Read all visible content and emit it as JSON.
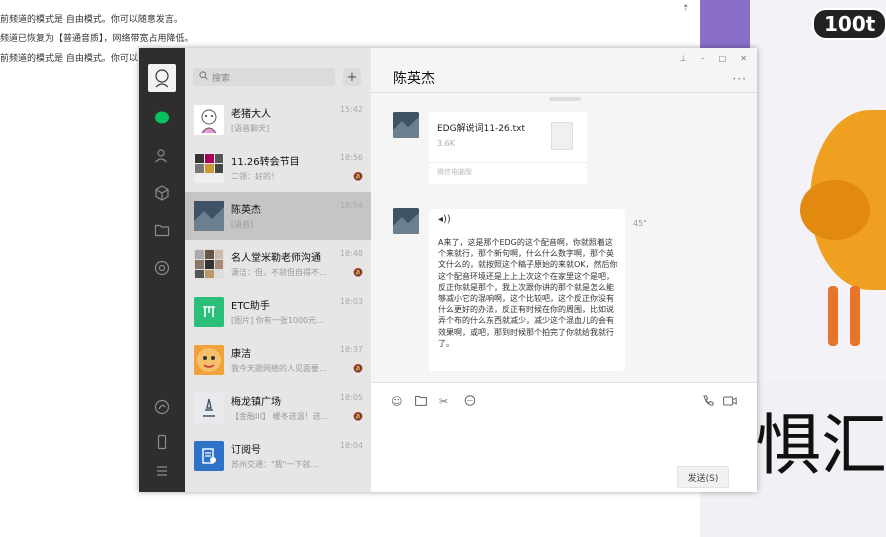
{
  "background": {
    "lines": [
      "前频道的模式是 自由模式。你可以随意发言。",
      "频道已恢复为【普通音质】，网络带宽占用降低。",
      "前频道的模式是 自由模式。你可以"
    ],
    "top_icon": "pin-icon",
    "video_badge": "100t",
    "video_caption": "惧汇总"
  },
  "wechat": {
    "window_controls": [
      "⊥",
      "–",
      "□",
      "✕"
    ],
    "rail_icons": [
      "chat-icon",
      "contacts-icon",
      "favorites-icon",
      "files-icon",
      "moments-icon",
      "mini-program-icon",
      "phone-icon",
      "menu-icon"
    ],
    "search_placeholder": "搜索",
    "add_label": "+",
    "conversations": [
      {
        "name": "老猪大人",
        "preview": "[语音聊天]",
        "time": "15:42",
        "muted": false
      },
      {
        "name": "11.26转会节目",
        "preview": "二领：好的！",
        "time": "18:56",
        "muted": true
      },
      {
        "name": "陈英杰",
        "preview": "[语音]",
        "time": "18:54",
        "muted": false,
        "selected": true
      },
      {
        "name": "名人堂米勒老师沟通",
        "preview": "潇洁：但，不就但自得不…",
        "time": "18:48",
        "muted": true
      },
      {
        "name": "ETC助手",
        "preview": "[图片] 你有一张1000元…",
        "time": "18:03",
        "muted": false
      },
      {
        "name": "康洁",
        "preview": "我今天跟网络的人见面要…",
        "time": "18:37",
        "muted": true
      },
      {
        "name": "梅龙镇广场",
        "preview": "【金融III】 暖冬送温！送…",
        "time": "18:05",
        "muted": true
      },
      {
        "name": "订阅号",
        "preview": "苏州交通：\"我\"一下就…",
        "time": "18:04",
        "muted": false
      }
    ],
    "chat": {
      "title": "陈英杰",
      "more": "···",
      "file": {
        "name": "EDG解说词11-26.txt",
        "size": "3.6K",
        "source": "微信电脑版"
      },
      "voice": {
        "text": "A来了，这是那个EDG的这个配音啊，你就照着这个来就行，那个新句啊，什么什么数字啊，那个英文什么的，就按照这个稿子原始的来就OK，然后你这个配音环境还是上上上次这个在家里这个是吧，反正你就是那个，我上次跟你讲的那个就是怎么能够减小它的混响啊，这个比较吧，这个反正你没有什么更好的办法，反正有时候在你的周围，比如说弄个布的什么东西就减少，减少这个混血儿的会有效果啊，或吧，那到时候那个拍完了你就给我就行了。",
        "duration": "45\""
      },
      "tools": [
        "emoji-icon",
        "folder-icon",
        "scissors-icon",
        "chat-bubble-icon"
      ],
      "call_tools": [
        "phone-icon",
        "video-icon"
      ],
      "send_label": "发送(S)"
    }
  }
}
